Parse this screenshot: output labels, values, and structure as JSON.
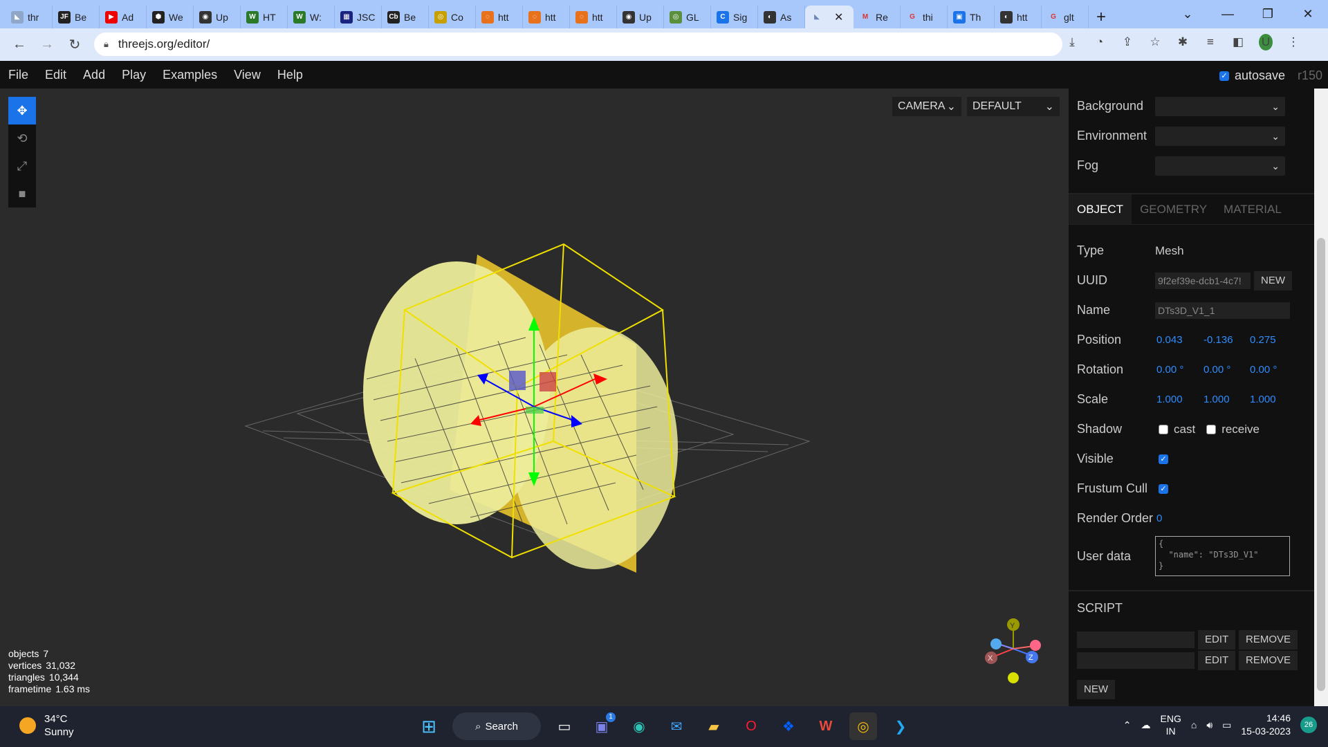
{
  "browser": {
    "tabs": [
      {
        "label": "thr",
        "color": "#8fa6c9",
        "glyph": "◣"
      },
      {
        "label": "Be",
        "color": "#222",
        "glyph": "JF"
      },
      {
        "label": "Ad",
        "color": "#e00",
        "glyph": "▶"
      },
      {
        "label": "We",
        "color": "#222",
        "glyph": "⬢"
      },
      {
        "label": "Up",
        "color": "#333",
        "glyph": "◉"
      },
      {
        "label": "HT",
        "color": "#2a7a2a",
        "glyph": "W"
      },
      {
        "label": "W:",
        "color": "#2a7a2a",
        "glyph": "W"
      },
      {
        "label": "JSC",
        "color": "#1a237e",
        "glyph": "▦"
      },
      {
        "label": "Be",
        "color": "#222",
        "glyph": "Cb"
      },
      {
        "label": "Co",
        "color": "#c7a000",
        "glyph": "◎"
      },
      {
        "label": "htt",
        "color": "#e8711c",
        "glyph": "◌"
      },
      {
        "label": "htt",
        "color": "#e8711c",
        "glyph": "◌"
      },
      {
        "label": "htt",
        "color": "#e8711c",
        "glyph": "◌"
      },
      {
        "label": "Up",
        "color": "#333",
        "glyph": "◉"
      },
      {
        "label": "GL",
        "color": "#5a8f3c",
        "glyph": "◎"
      },
      {
        "label": "Sig",
        "color": "#1a73e8",
        "glyph": "C"
      },
      {
        "label": "As",
        "color": "#333",
        "glyph": "◐"
      }
    ],
    "active_tab": {
      "label": "",
      "glyph": "◣"
    },
    "tabs_after": [
      {
        "label": "Re",
        "color": "#fff",
        "glyph": "M"
      },
      {
        "label": "thi",
        "color": "#fff",
        "glyph": "G"
      },
      {
        "label": "Th",
        "color": "#1a73e8",
        "glyph": "▣"
      },
      {
        "label": "htt",
        "color": "#333",
        "glyph": "◐"
      },
      {
        "label": "glt",
        "color": "#fff",
        "glyph": "G"
      }
    ],
    "new_tab": "+",
    "url": "threejs.org/editor/"
  },
  "menubar": {
    "items": [
      "File",
      "Edit",
      "Add",
      "Play",
      "Examples",
      "View",
      "Help"
    ],
    "autosave_label": "autosave",
    "version": "r150"
  },
  "viewport": {
    "camera_select": "CAMERA",
    "shading_select": "DEFAULT",
    "info": {
      "objects_label": "objects",
      "objects": "7",
      "vertices_label": "vertices",
      "vertices": "31,032",
      "triangles_label": "triangles",
      "triangles": "10,344",
      "frametime_label": "frametime",
      "frametime": "1.63 ms"
    },
    "gizmo": {
      "x": "X",
      "y": "Y",
      "z": "Z"
    }
  },
  "scene_panel": {
    "background_label": "Background",
    "environment_label": "Environment",
    "fog_label": "Fog"
  },
  "object_panel": {
    "tabs": [
      "OBJECT",
      "GEOMETRY",
      "MATERIAL"
    ],
    "type_label": "Type",
    "type": "Mesh",
    "uuid_label": "UUID",
    "uuid": "9f2ef39e-dcb1-4c7!",
    "uuid_new": "NEW",
    "name_label": "Name",
    "name": "DTs3D_V1_1",
    "position_label": "Position",
    "position": [
      "0.043",
      "-0.136",
      "0.275"
    ],
    "rotation_label": "Rotation",
    "rotation": [
      "0.00 °",
      "0.00 °",
      "0.00 °"
    ],
    "scale_label": "Scale",
    "scale": [
      "1.000",
      "1.000",
      "1.000"
    ],
    "shadow_label": "Shadow",
    "cast_label": "cast",
    "receive_label": "receive",
    "visible_label": "Visible",
    "frustum_label": "Frustum Cull",
    "render_order_label": "Render Order",
    "render_order": "0",
    "userdata_label": "User data",
    "userdata": "{\n  \"name\": \"DTs3D_V1\"\n}"
  },
  "script_panel": {
    "title": "SCRIPT",
    "edit_label": "EDIT",
    "remove_label": "REMOVE",
    "new_label": "NEW"
  },
  "taskbar": {
    "temp": "34°C",
    "condition": "Sunny",
    "search": "Search",
    "lang1": "ENG",
    "lang2": "IN",
    "time": "14:46",
    "date": "15-03-2023",
    "notif_count": "26",
    "chat_badge": "1"
  }
}
